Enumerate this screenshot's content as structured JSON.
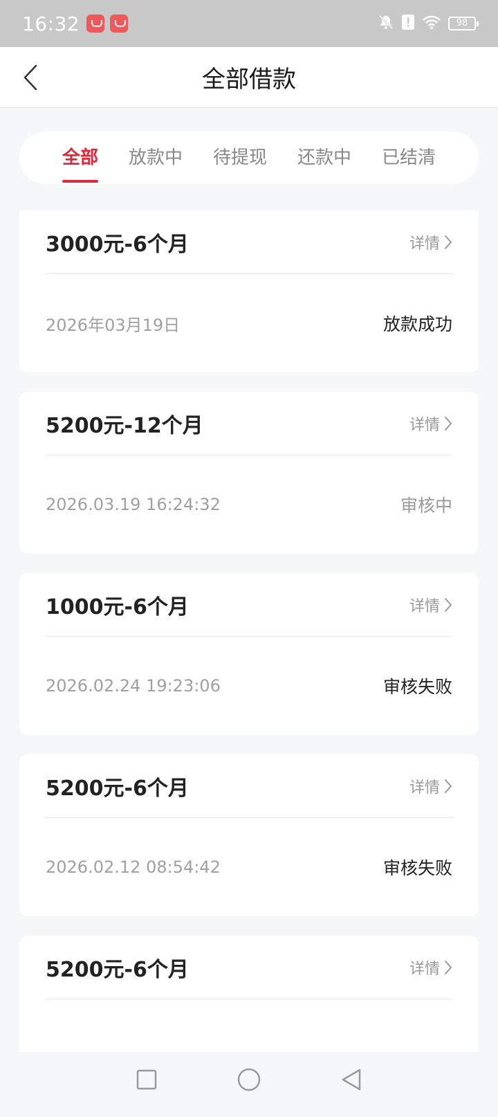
{
  "status_bar": {
    "time": "16:32",
    "battery": "98",
    "icons": [
      "bell-off-icon",
      "alert-icon",
      "wifi-icon",
      "battery-icon"
    ]
  },
  "header": {
    "title": "全部借款",
    "back_icon": "chevron-left-icon"
  },
  "tabs": [
    {
      "label": "全部",
      "active": true
    },
    {
      "label": "放款中",
      "active": false
    },
    {
      "label": "待提现",
      "active": false
    },
    {
      "label": "还款中",
      "active": false
    },
    {
      "label": "已结清",
      "active": false
    }
  ],
  "loans": [
    {
      "amount": "3000元-6个月",
      "detail": "详情",
      "date": "2026年03月19日",
      "status": "放款成功"
    },
    {
      "amount": "5200元-12个月",
      "detail": "详情",
      "date": "2026.03.19 16:24:32",
      "status": "审核中"
    },
    {
      "amount": "1000元-6个月",
      "detail": "详情",
      "date": "2026.02.24 19:23:06",
      "status": "审核失败"
    },
    {
      "amount": "5200元-6个月",
      "detail": "详情",
      "date": "2026.02.12 08:54:42",
      "status": "审核失败"
    },
    {
      "amount": "5200元-6个月",
      "detail": "详情",
      "date": "",
      "status": ""
    }
  ],
  "colors": {
    "accent": "#e0283c",
    "background": "#f6f7f9",
    "status_bar": "#c8c8c8"
  }
}
